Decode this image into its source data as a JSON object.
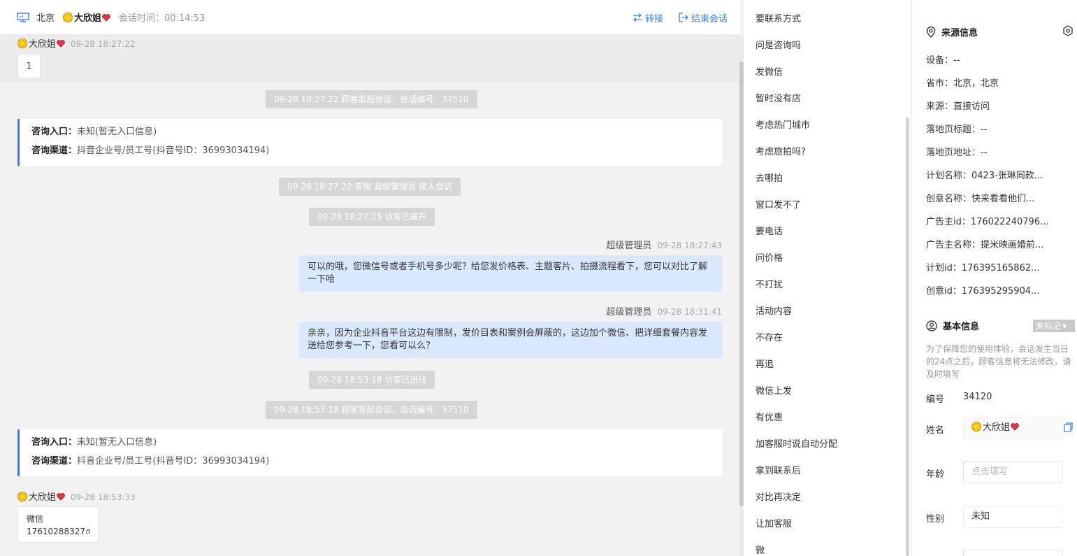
{
  "header": {
    "city": "北京",
    "visitor_name": "大欣姐",
    "session_time": "会话时间：00:14:53",
    "transfer_label": "转接",
    "end_label": "结束会话"
  },
  "messages": {
    "m1_sender": "大欣姐",
    "m1_time": "09-28 18:27:22",
    "m1_text": "1",
    "sys1": "09-28 18:27:22 顾客发起会话，会话编号：37510",
    "card1_entry_key": "咨询入口：",
    "card1_entry_val": "未知(暂无入口信息)",
    "card1_channel_key": "咨询渠道：",
    "card1_channel_val": "抖音企业号/员工号(抖音号ID：36993034194)",
    "sys2": "09-28 18:27:22 客服 超级管理员 接入会话",
    "sys3": "09-28 18:27:25 访客已离开",
    "agent1_name": "超级管理员",
    "agent1_time": "09-28 18:27:43",
    "agent1_text": "可以的哦，您微信号或者手机号多少呢？给您发价格表、主题客片、拍摄流程看下，您可以对比了解一下哈",
    "agent2_name": "超级管理员",
    "agent2_time": "09-28 18:31:41",
    "agent2_text": "亲亲，因为企业抖音平台这边有限制，发价目表和案例会屏蔽的，这边加个微信、把详细套餐内容发送给您参考一下，您看可以么？",
    "sys4": "09-28 18:53:18 访客已进线",
    "sys5": "09-28 18:53:18 顾客发起会话，会话编号：37510",
    "card2_entry_key": "咨询入口：",
    "card2_entry_val": "未知(暂无入口信息)",
    "card2_channel_key": "咨询渠道：",
    "card2_channel_val": "抖音企业号/员工号(抖音号ID：36993034194)",
    "m2_sender": "大欣姐",
    "m2_time": "09-28 18:53:33",
    "m2_line1": "微信",
    "m2_line2": "17610288327"
  },
  "phrases": [
    "要联系方式",
    "问是咨询吗",
    "发微信",
    "暂时没有店",
    "考虑热门城市",
    "考虑旅拍吗?",
    "去哪拍",
    "窗口发不了",
    "要电话",
    "问价格",
    "不打扰",
    "活动内容",
    "不存在",
    "再追",
    "微信上发",
    "有优惠",
    "加客服时说自动分配",
    "拿到联系后",
    "对比再决定",
    "让加客服",
    "微"
  ],
  "source": {
    "title": "来源信息",
    "device": "设备：--",
    "province": "省市：北京，北京",
    "origin": "来源：直接访问",
    "landing_title": "落地页标题：--",
    "landing_url": "落地页地址：--",
    "plan_name": "计划名称：0423-张琳同款...",
    "creative_name": "创意名称：快来看看他们...",
    "advertiser_id": "广告主id：176022240796...",
    "advertiser_name": "广告主名称：提米映画婚前...",
    "plan_id": "计划id：176395165862...",
    "creative_id": "创意id：176395295904..."
  },
  "basic": {
    "title": "基本信息",
    "tag": "未标记",
    "note": "为了保障您的使用体验，会话发生当日的24点之后，顾客信息将无法修改，请及时填写",
    "id_label": "编号",
    "id_value": "34120",
    "name_label": "姓名",
    "name_value": "大欣姐",
    "age_label": "年龄",
    "age_placeholder": "点击填写",
    "gender_label": "性别",
    "gender_value": "未知"
  },
  "colors": {
    "accent": "#3a7de8",
    "agent_bubble": "#d9e8fd",
    "system_pill": "#d6d6d6"
  }
}
